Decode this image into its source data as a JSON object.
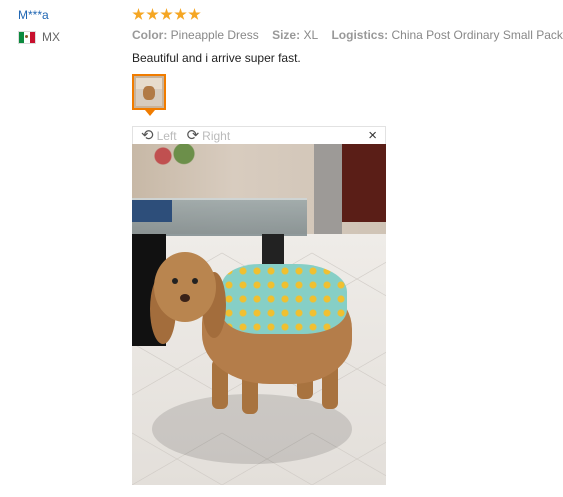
{
  "user": {
    "name": "M***a",
    "country_code": "MX",
    "flag_icon": "mexico-flag-icon"
  },
  "review": {
    "rating": 5,
    "color_label": "Color:",
    "color_value": "Pineapple Dress",
    "size_label": "Size:",
    "size_value": "XL",
    "logistics_label": "Logistics:",
    "logistics_value": "China Post Ordinary Small Packet",
    "text": "Beautiful and i arrive super fast."
  },
  "viewer": {
    "rotate_left_label": "Left",
    "rotate_right_label": "Right",
    "close_label": "×"
  },
  "accent_color": "#f07c00",
  "star_color": "#f5a623"
}
